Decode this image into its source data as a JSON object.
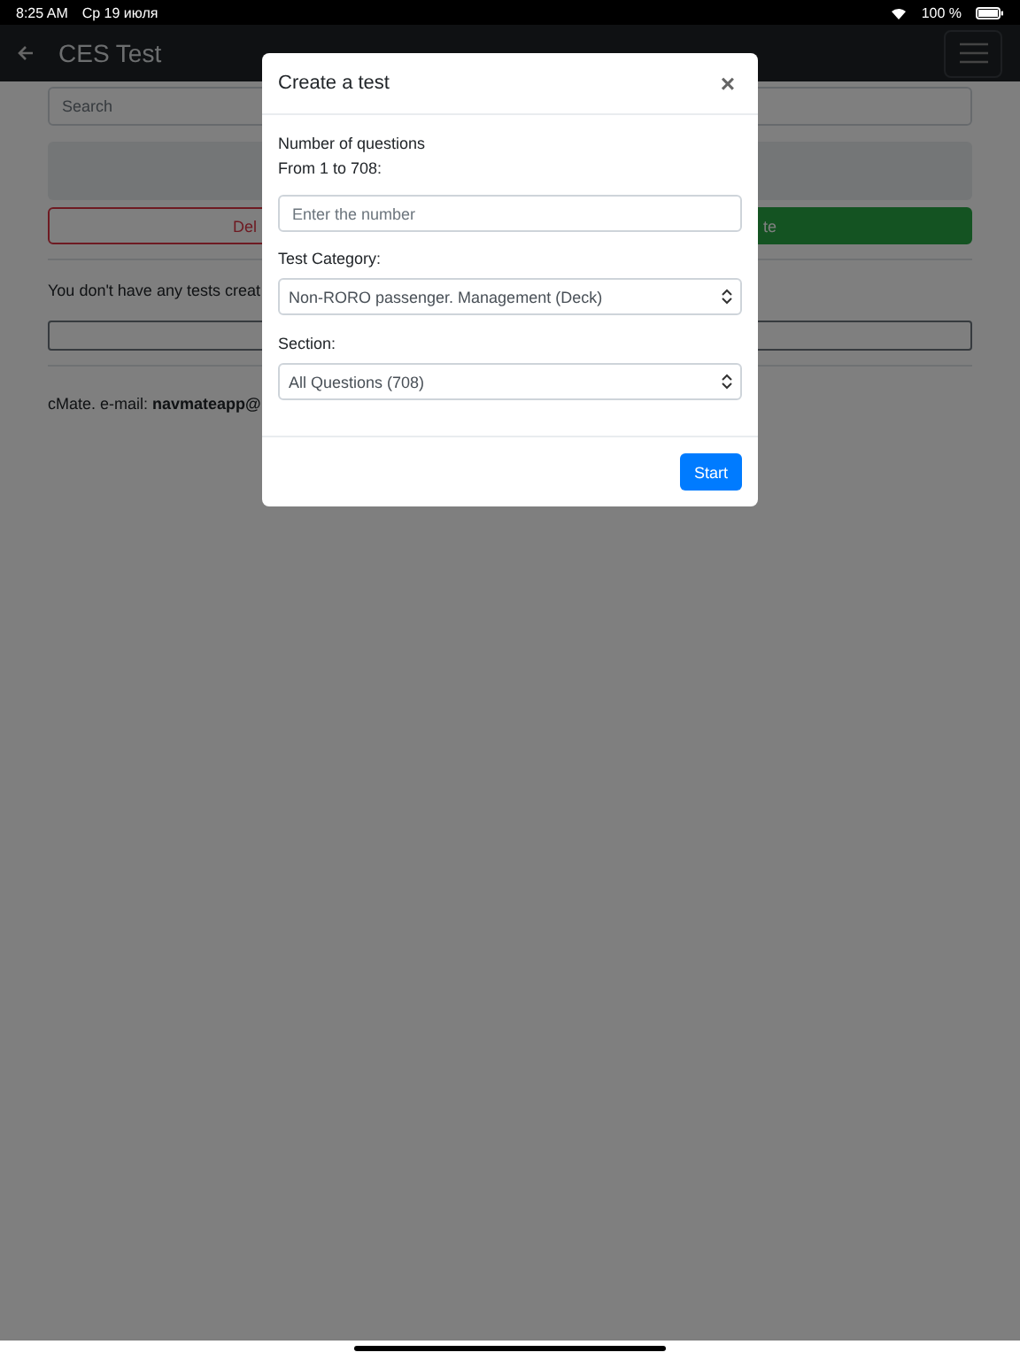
{
  "status_bar": {
    "time": "8:25 AM",
    "date": "Ср 19 июля",
    "battery": "100 %"
  },
  "nav": {
    "title": "CES Test"
  },
  "search": {
    "placeholder": "Search"
  },
  "buttons": [
    {
      "label": "Del",
      "kind": "danger"
    },
    {
      "label": "te",
      "kind": "success"
    }
  ],
  "empty_message": "You don't have any tests creat",
  "footer": "cMate. e-mail: **navmateapp@**",
  "modal": {
    "title": "Create a test",
    "close": "×",
    "count_label": "Number of questions",
    "range_label": "From 1 to 708:",
    "count_placeholder": "Enter the number",
    "category_label": "Test Category:",
    "category_value": "Non-RORO passenger. Management (Deck)",
    "section_label": "Section:",
    "section_value": "All Questions (708)",
    "start": "Start"
  }
}
